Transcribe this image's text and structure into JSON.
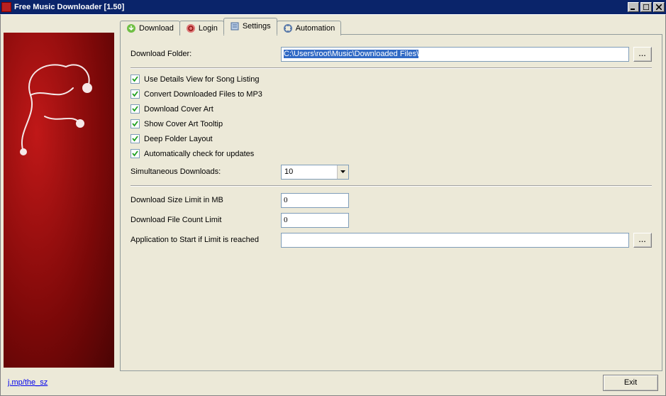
{
  "window": {
    "title": "Free Music Downloader [1.50]"
  },
  "tabs": {
    "download": "Download",
    "login": "Login",
    "settings": "Settings",
    "automation": "Automation",
    "active": "settings"
  },
  "settings": {
    "download_folder_label": "Download Folder:",
    "download_folder_value": "C:\\Users\\root\\Music\\Downloaded Files\\",
    "browse_label": "...",
    "checkboxes": {
      "details_view": {
        "label": "Use Details View for Song Listing",
        "checked": true
      },
      "convert_mp3": {
        "label": "Convert Downloaded Files to MP3",
        "checked": true
      },
      "cover_art": {
        "label": "Download Cover Art",
        "checked": true
      },
      "cover_tooltip": {
        "label": "Show Cover Art Tooltip",
        "checked": true
      },
      "deep_folder": {
        "label": "Deep Folder Layout",
        "checked": true
      },
      "updates": {
        "label": "Automatically check for updates",
        "checked": true
      }
    },
    "sim_downloads_label": "Simultaneous Downloads:",
    "sim_downloads_value": "10",
    "size_limit_label": "Download Size Limit in MB",
    "size_limit_value": "0",
    "count_limit_label": "Download File Count Limit",
    "count_limit_value": "0",
    "limit_app_label": "Application to Start if Limit is reached",
    "limit_app_value": ""
  },
  "footer": {
    "link_text": "j.mp/the_sz",
    "exit_label": "Exit"
  },
  "colors": {
    "accent": "#0a246a",
    "sidebar_red": "#8a0c0c"
  }
}
